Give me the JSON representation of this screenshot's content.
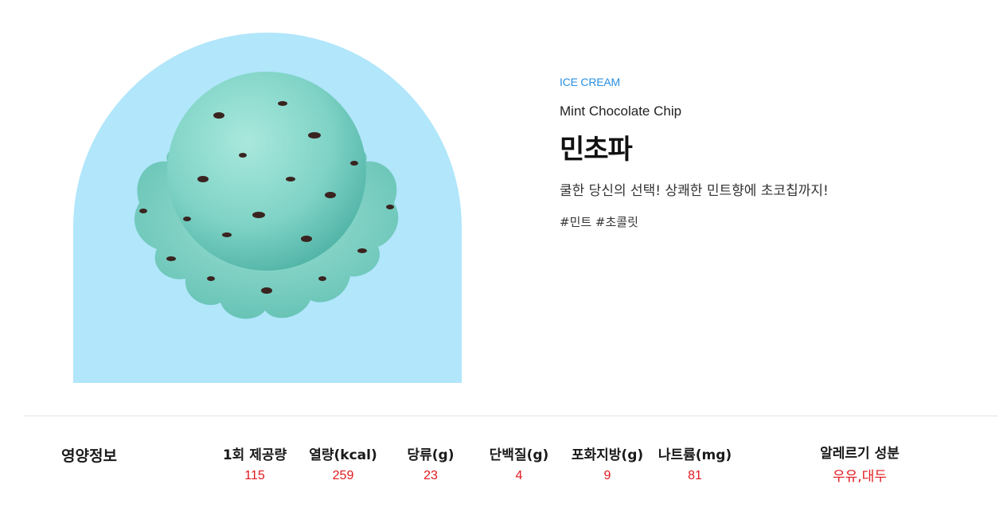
{
  "product": {
    "category": "ICE CREAM",
    "english_name": "Mint Chocolate Chip",
    "korean_name": "민초파",
    "description": "쿨한 당신의 선택! 상쾌한 민트향에 초코칩까지!",
    "tags": "#민트 #초콜릿",
    "image": "mint-chocolate-chip-scoop",
    "arch_color": "#b1e6fb",
    "scoop_color": "#7fd3c6"
  },
  "nutrition": {
    "title": "영양정보",
    "items": [
      {
        "label": "1회 제공량",
        "value": "115"
      },
      {
        "label": "열량(kcal)",
        "value": "259"
      },
      {
        "label": "당류(g)",
        "value": "23"
      },
      {
        "label": "단백질(g)",
        "value": "4"
      },
      {
        "label": "포화지방(g)",
        "value": "9"
      },
      {
        "label": "나트륨(mg)",
        "value": "81"
      }
    ],
    "allergy": {
      "label": "알레르기 성분",
      "value": "우유,대두"
    }
  }
}
